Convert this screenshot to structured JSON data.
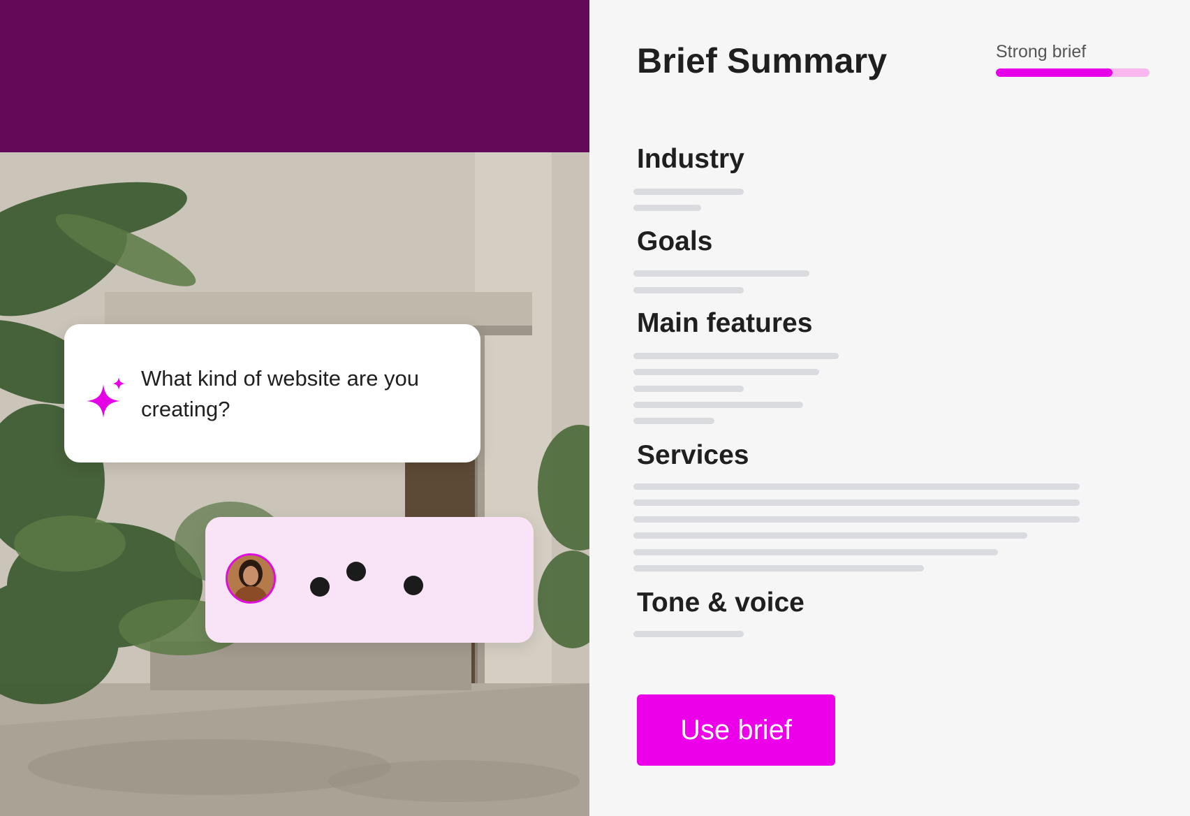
{
  "chat": {
    "question": "What kind of website are you creating?",
    "icons": {
      "assistant": "sparkle-icon",
      "user": "avatar"
    },
    "typing_indicator": "typing-dots"
  },
  "summary": {
    "title": "Brief Summary",
    "strength": {
      "label": "Strong brief",
      "level": 0.76
    },
    "sections": [
      {
        "heading": "Industry"
      },
      {
        "heading": "Goals"
      },
      {
        "heading": "Main features"
      },
      {
        "heading": "Services"
      },
      {
        "heading": "Tone & voice"
      }
    ],
    "use_button_label": "Use brief"
  },
  "colors": {
    "accent": "#ec00e9",
    "band": "#640957",
    "user_bubble": "#f8e3f7",
    "panel": "#f6f6f6"
  }
}
